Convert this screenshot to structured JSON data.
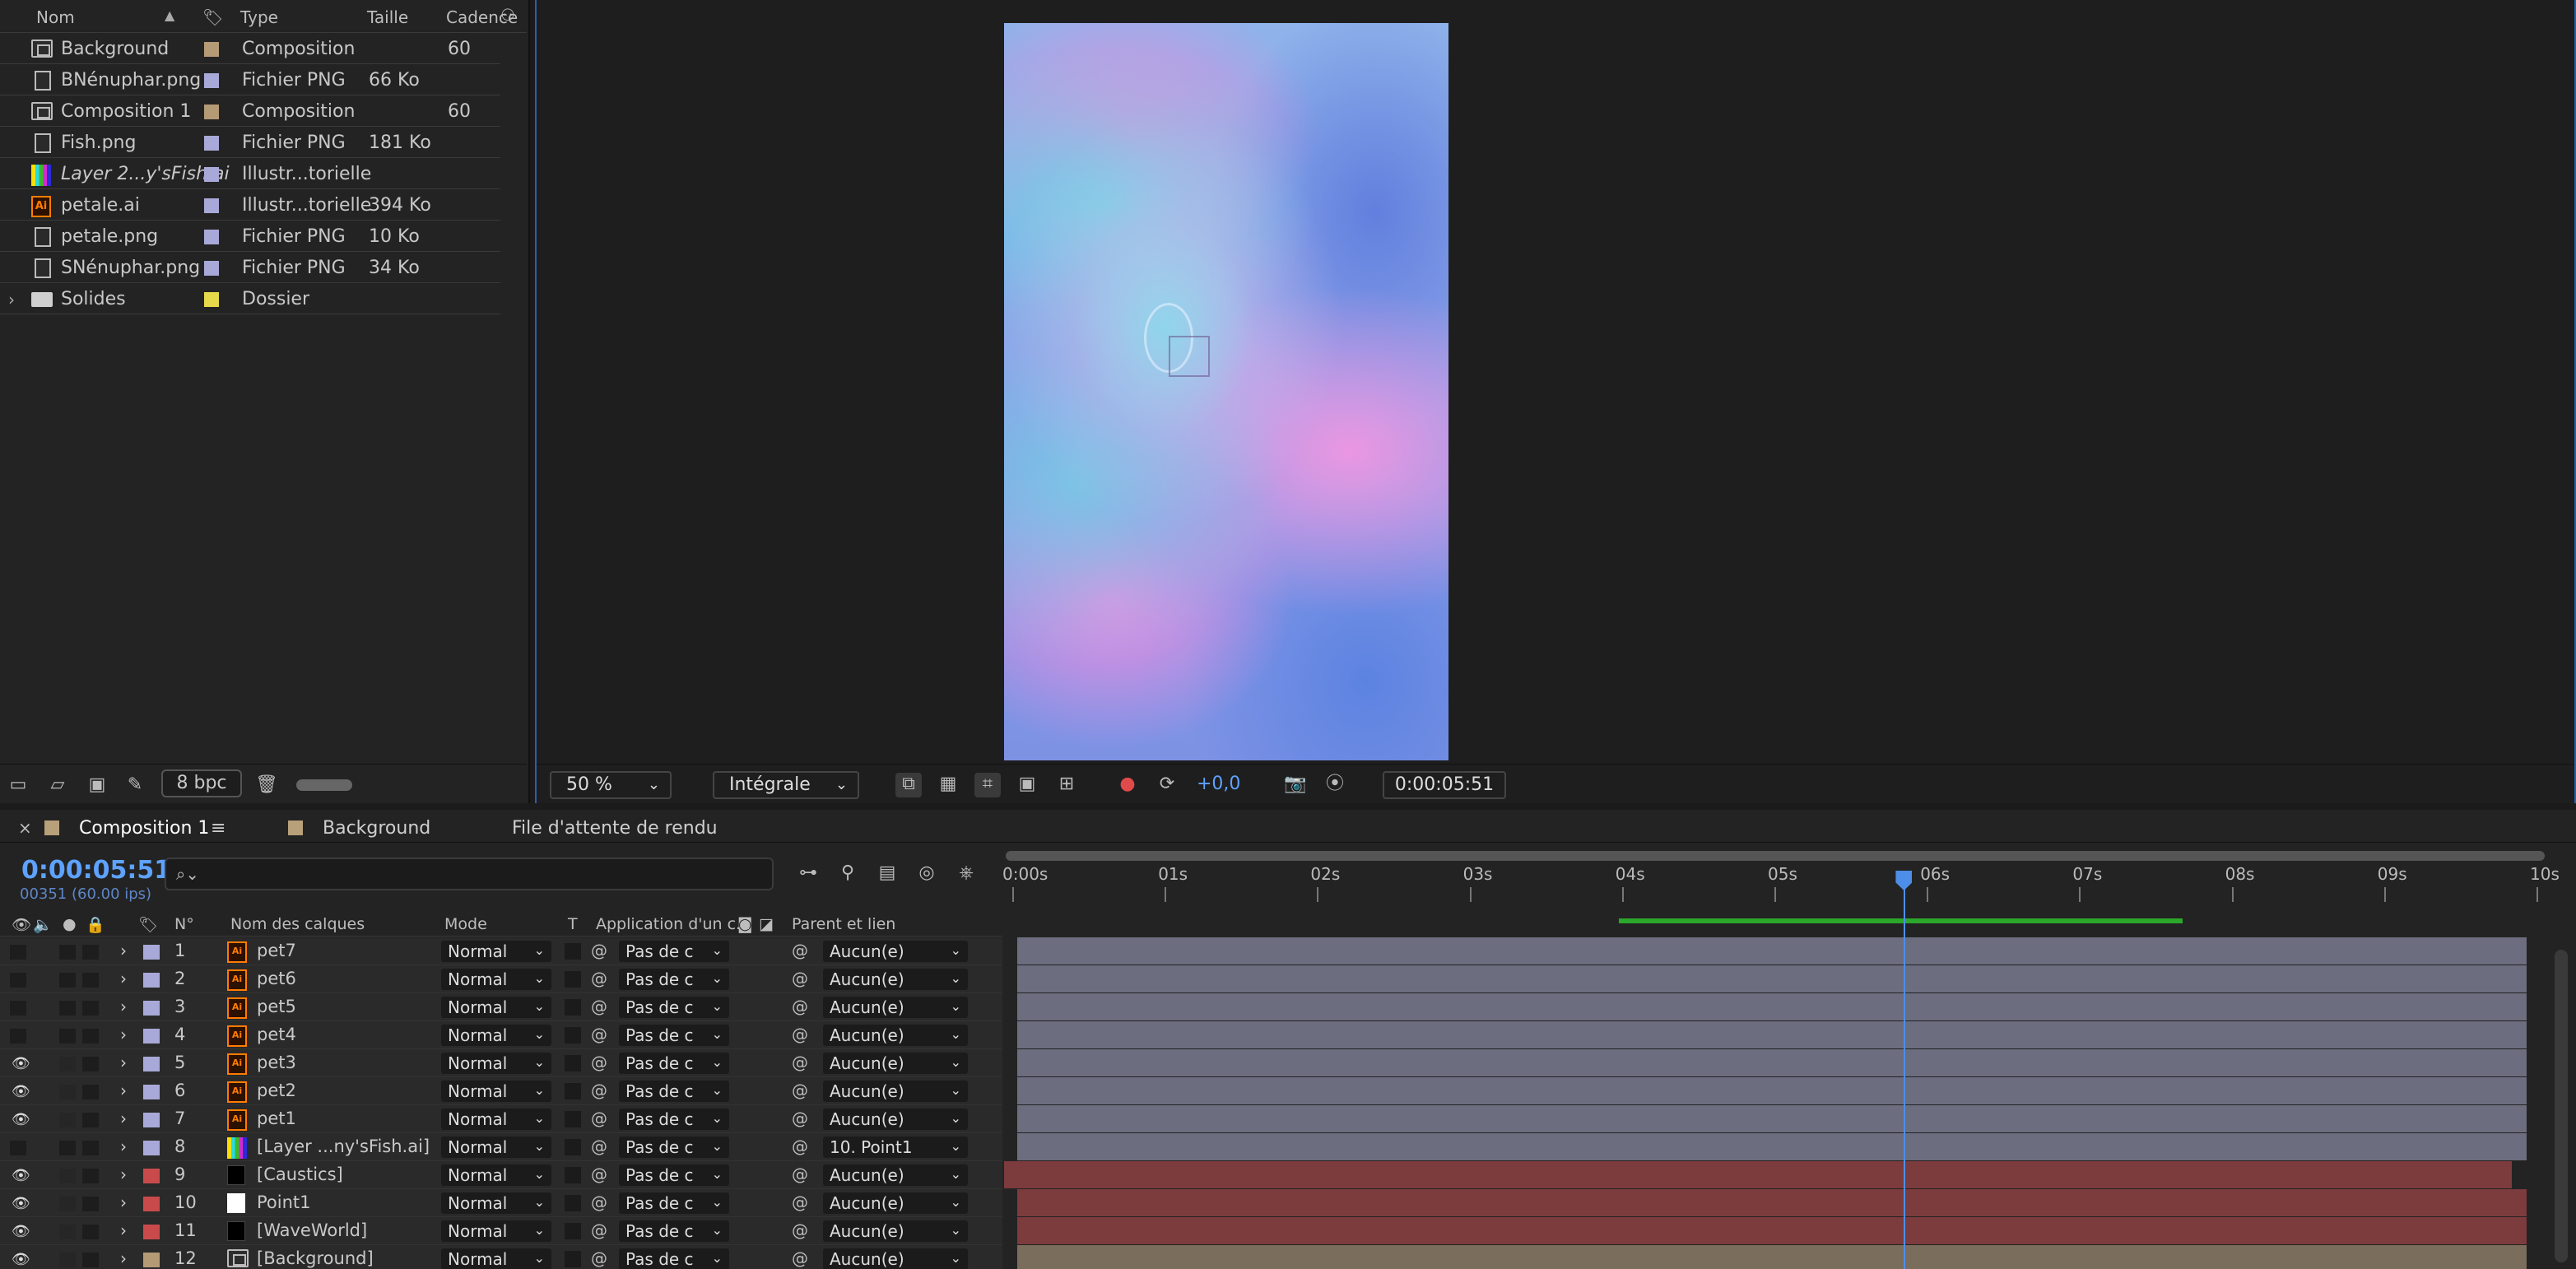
{
  "project": {
    "headers": {
      "name": "Nom",
      "type": "Type",
      "size": "Taille",
      "rate": "Cadence"
    },
    "items": [
      {
        "icon": "composition-icon",
        "name": "Background",
        "label_color": "#b59a76",
        "type": "Composition",
        "size": "",
        "rate": "60"
      },
      {
        "icon": "png-file-icon",
        "name": "BNénuphar.png",
        "label_color": "#a8a9d8",
        "type": "Fichier PNG",
        "size": "66 Ko",
        "rate": ""
      },
      {
        "icon": "composition-icon",
        "name": "Composition 1",
        "label_color": "#b59a76",
        "type": "Composition",
        "size": "",
        "rate": "60"
      },
      {
        "icon": "png-file-icon",
        "name": "Fish.png",
        "label_color": "#a8a9d8",
        "type": "Fichier PNG",
        "size": "181 Ko",
        "rate": ""
      },
      {
        "icon": "illustrator-layer-icon",
        "name": "Layer 2...y'sFish.ai",
        "label_color": "#a8a9d8",
        "type": "Illustr...torielle",
        "size": "",
        "rate": ""
      },
      {
        "icon": "ai-file-icon",
        "name": "petale.ai",
        "label_color": "#a8a9d8",
        "type": "Illustr...torielle",
        "size": "394 Ko",
        "rate": ""
      },
      {
        "icon": "png-file-icon",
        "name": "petale.png",
        "label_color": "#a8a9d8",
        "type": "Fichier PNG",
        "size": "10 Ko",
        "rate": ""
      },
      {
        "icon": "png-file-icon",
        "name": "SNénuphar.png",
        "label_color": "#a8a9d8",
        "type": "Fichier PNG",
        "size": "34 Ko",
        "rate": ""
      },
      {
        "icon": "folder-icon",
        "name": "Solides",
        "label_color": "#e6d94a",
        "type": "Dossier",
        "size": "",
        "rate": ""
      }
    ],
    "footer": {
      "bpc": "8 bpc"
    }
  },
  "viewer": {
    "zoom": "50 %",
    "resolution": "Intégrale",
    "exposure": "+0,0",
    "timecode": "0:00:05:51"
  },
  "timeline": {
    "tabs": [
      {
        "label": "Composition 1",
        "menu": "≡"
      },
      {
        "label": "Background"
      },
      {
        "label": "File d'attente de rendu"
      }
    ],
    "current_time": "0:00:05:51",
    "current_frames": "00351 (60.00 ips)",
    "columns": {
      "num": "N°",
      "layer_name": "Nom des calques",
      "mode": "Mode",
      "trkmat": "T",
      "track_matte": "Application d'un c...",
      "parent": "Parent et lien"
    },
    "ruler": [
      "0:00s",
      "01s",
      "02s",
      "03s",
      "04s",
      "05s",
      "06s",
      "07s",
      "08s",
      "09s",
      "10s"
    ],
    "playhead_seconds": 5.85,
    "duration_seconds": 10,
    "green_range_seconds": [
      4.0,
      7.7
    ],
    "layers": [
      {
        "num": "1",
        "name": "pet7",
        "visible": false,
        "label_color": "#a8a9d8",
        "icon": "ai-file-icon",
        "mode": "Normal",
        "matte": "Pas de c",
        "parent": "Aucun(e)",
        "bar_color": "#6c6d7f"
      },
      {
        "num": "2",
        "name": "pet6",
        "visible": false,
        "label_color": "#a8a9d8",
        "icon": "ai-file-icon",
        "mode": "Normal",
        "matte": "Pas de c",
        "parent": "Aucun(e)",
        "bar_color": "#6c6d7f"
      },
      {
        "num": "3",
        "name": "pet5",
        "visible": false,
        "label_color": "#a8a9d8",
        "icon": "ai-file-icon",
        "mode": "Normal",
        "matte": "Pas de c",
        "parent": "Aucun(e)",
        "bar_color": "#6c6d7f"
      },
      {
        "num": "4",
        "name": "pet4",
        "visible": false,
        "label_color": "#a8a9d8",
        "icon": "ai-file-icon",
        "mode": "Normal",
        "matte": "Pas de c",
        "parent": "Aucun(e)",
        "bar_color": "#6c6d7f"
      },
      {
        "num": "5",
        "name": "pet3",
        "visible": true,
        "label_color": "#a8a9d8",
        "icon": "ai-file-icon",
        "mode": "Normal",
        "matte": "Pas de c",
        "parent": "Aucun(e)",
        "bar_color": "#6c6d7f"
      },
      {
        "num": "6",
        "name": "pet2",
        "visible": true,
        "label_color": "#a8a9d8",
        "icon": "ai-file-icon",
        "mode": "Normal",
        "matte": "Pas de c",
        "parent": "Aucun(e)",
        "bar_color": "#6c6d7f"
      },
      {
        "num": "7",
        "name": "pet1",
        "visible": true,
        "label_color": "#a8a9d8",
        "icon": "ai-file-icon",
        "mode": "Normal",
        "matte": "Pas de c",
        "parent": "Aucun(e)",
        "bar_color": "#6c6d7f"
      },
      {
        "num": "8",
        "name": "[Layer ...ny'sFish.ai]",
        "visible": false,
        "label_color": "#a8a9d8",
        "icon": "illustrator-layer-icon",
        "mode": "Normal",
        "matte": "Pas de c",
        "parent": "10. Point1",
        "bar_color": "#6c6d7f"
      },
      {
        "num": "9",
        "name": "[Caustics]",
        "visible": true,
        "label_color": "#c94a4a",
        "icon": "solid-black-icon",
        "mode": "Normal",
        "matte": "Pas de c",
        "parent": "Aucun(e)",
        "bar_color": "#7c3b3d"
      },
      {
        "num": "10",
        "name": "Point1",
        "visible": true,
        "label_color": "#c94a4a",
        "icon": "solid-white-icon",
        "mode": "Normal",
        "matte": "Pas de c",
        "parent": "Aucun(e)",
        "bar_color": "#7c3b3d"
      },
      {
        "num": "11",
        "name": "[WaveWorld]",
        "visible": true,
        "label_color": "#c94a4a",
        "icon": "solid-black-icon",
        "mode": "Normal",
        "matte": "Pas de c",
        "parent": "Aucun(e)",
        "bar_color": "#7c3b3d"
      },
      {
        "num": "12",
        "name": "[Background]",
        "visible": true,
        "label_color": "#b59a76",
        "icon": "composition-icon",
        "mode": "Normal",
        "matte": "Pas de c",
        "parent": "Aucun(e)",
        "bar_color": "#7a6d5c"
      }
    ]
  }
}
